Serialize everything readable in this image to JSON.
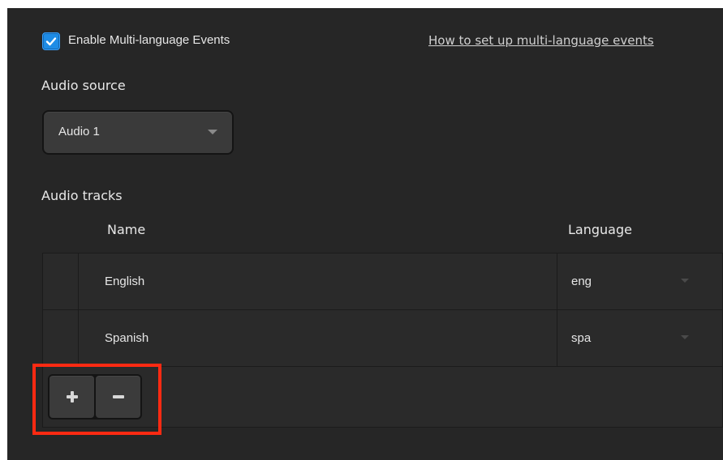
{
  "settings": {
    "enable_multilang_label": "Enable Multi-language Events",
    "enable_multilang_checked": true,
    "help_link": "How to set up multi-language events"
  },
  "audio_source": {
    "label": "Audio source",
    "selected": "Audio 1"
  },
  "audio_tracks": {
    "label": "Audio tracks",
    "columns": {
      "name": "Name",
      "language": "Language"
    },
    "rows": [
      {
        "name": "English",
        "language": "eng"
      },
      {
        "name": "Spanish",
        "language": "spa"
      }
    ]
  },
  "icons": {
    "checkbox": "checkmark-icon",
    "select_caret": "chevron-down-icon",
    "add": "plus-icon",
    "remove": "minus-icon"
  },
  "colors": {
    "accent": "#1e8ce6",
    "highlight": "#ff2a12",
    "panel": "#262626"
  }
}
